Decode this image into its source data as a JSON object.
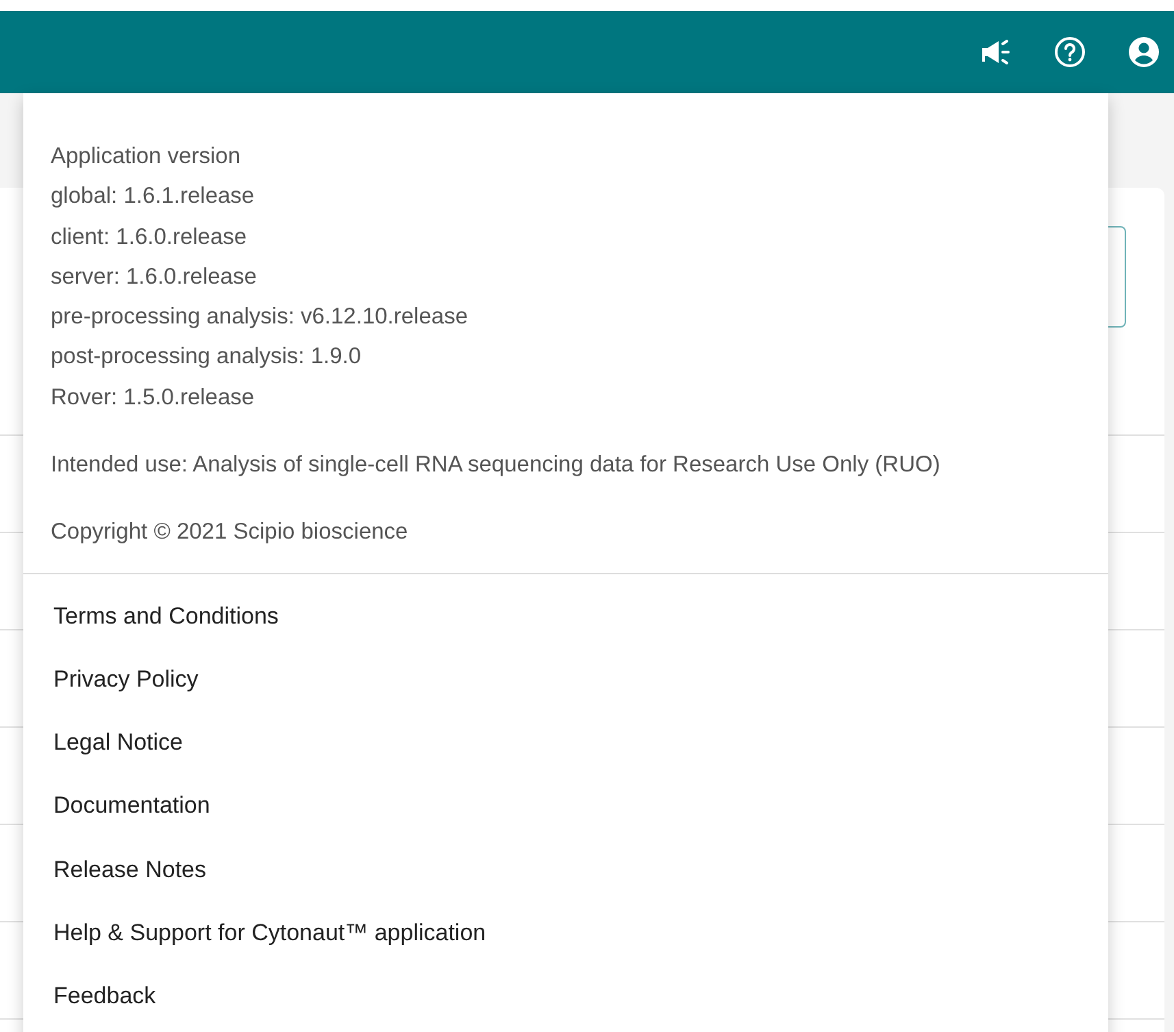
{
  "about": {
    "lines": [
      "Application version",
      "global: 1.6.1.release",
      "client: 1.6.0.release",
      "server: 1.6.0.release",
      "pre-processing analysis: v6.12.10.release",
      "post-processing analysis: 1.9.0",
      "Rover: 1.5.0.release"
    ],
    "intended_use": "Intended use: Analysis of single-cell RNA sequencing data for Research Use Only (RUO)",
    "copyright": "Copyright © 2021 Scipio bioscience"
  },
  "menu_items": [
    {
      "label": "Terms and Conditions"
    },
    {
      "label": "Privacy Policy"
    },
    {
      "label": "Legal Notice"
    },
    {
      "label": "Documentation"
    },
    {
      "label": "Release Notes"
    },
    {
      "label": "Help & Support for Cytonaut™ application"
    },
    {
      "label": "Feedback"
    }
  ]
}
